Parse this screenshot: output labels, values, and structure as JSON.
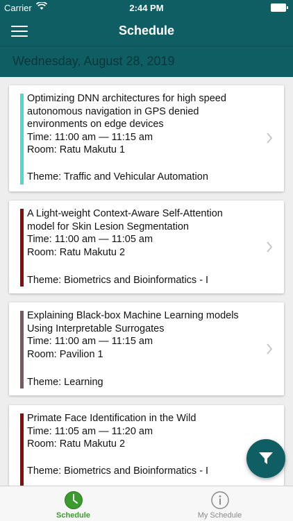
{
  "status_bar": {
    "carrier": "Carrier",
    "time": "2:44 PM"
  },
  "nav": {
    "title": "Schedule"
  },
  "date_header": "Wednesday, August 28, 2019",
  "sessions": [
    {
      "title_lines": [
        "Optimizing DNN architectures for high speed",
        "autonomous navigation in GPS denied",
        "environments on edge devices"
      ],
      "time": "Time: 11:00 am — 11:15 am",
      "room": "Room: Ratu Makutu 1",
      "theme": "Theme: Traffic and Vehicular Automation",
      "color": "#4dd9cf"
    },
    {
      "title_lines": [
        "A Light-weight Context-Aware Self-Attention",
        "model for Skin Lesion Segmentation"
      ],
      "time": "Time: 11:00 am — 11:05 am",
      "room": "Room: Ratu Makutu 2",
      "theme": "Theme: Biometrics and Bioinformatics - I",
      "color": "#8b0a0a"
    },
    {
      "title_lines": [
        "Explaining Black-box Machine Learning models",
        "Using Interpretable Surrogates"
      ],
      "time": "Time: 11:00 am — 11:15 am",
      "room": "Room: Pavilion 1",
      "theme": "Theme: Learning",
      "color": "#7a5a5a"
    },
    {
      "title_lines": [
        "Primate Face Identification in the Wild"
      ],
      "time": "Time: 11:05 am — 11:20 am",
      "room": "Room: Ratu Makutu 2",
      "theme": "Theme: Biometrics and Bioinformatics - I",
      "color": "#8b0a0a"
    }
  ],
  "tabs": {
    "schedule": "Schedule",
    "my_schedule": "My Schedule"
  },
  "colors": {
    "primary": "#0f5e64",
    "active_tab": "#3c9b2e",
    "inactive_tab": "#8a8a8a"
  },
  "icons": {
    "menu": "hamburger-menu-icon",
    "filter": "filter-funnel-icon",
    "schedule_tab": "clock-icon",
    "my_schedule_tab": "info-circle-icon"
  }
}
